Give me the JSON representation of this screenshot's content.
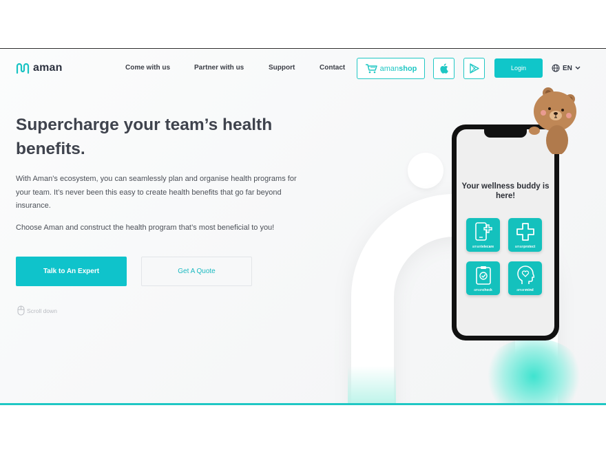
{
  "header": {
    "logo_text": "aman",
    "nav": [
      "Come with us",
      "Partner with us",
      "Support",
      "Contact"
    ],
    "shop_prefix": "aman",
    "shop_bold": "shop",
    "login_label": "Login",
    "language": "EN"
  },
  "hero": {
    "headline": "Supercharge your team’s health benefits.",
    "paragraph": "With Aman’s ecosystem, you can seamlessly plan and organise health programs for your team. It’s never been this easy to create health benefits that go far beyond insurance.",
    "paragraph2": "Choose Aman and construct the health program that’s most beneficial to you!",
    "cta_primary": "Talk to An Expert",
    "cta_secondary": "Get A Quote",
    "scroll_label": "Scroll down"
  },
  "phone": {
    "title": "Your wellness buddy is here!",
    "apps": [
      {
        "prefix": "aman",
        "name": "telecare",
        "icon": "phone-plus-icon"
      },
      {
        "prefix": "aman",
        "name": "protect",
        "icon": "cross-icon"
      },
      {
        "prefix": "aman",
        "name": "check",
        "icon": "clipboard-check-icon"
      },
      {
        "prefix": "aman",
        "name": "mind",
        "icon": "head-heart-icon"
      }
    ]
  },
  "colors": {
    "accent": "#10c6c9",
    "text": "#3a3d45",
    "app_tile": "#14c1bd"
  }
}
